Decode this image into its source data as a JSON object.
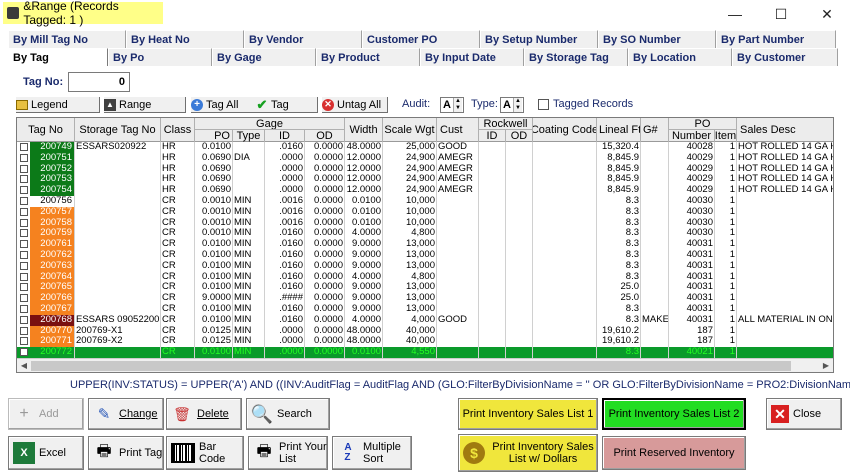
{
  "window": {
    "title": "&Range  (Records Tagged:  1 )",
    "minimize_glyph": "—",
    "maximize_glyph": "☐",
    "close_glyph": "✕"
  },
  "tabs_back": [
    "By Mill Tag No",
    "By Heat No",
    "By Vendor",
    "Customer PO",
    "By Setup Number",
    "By SO Number",
    "By Part Number"
  ],
  "tabs_front": [
    "By Tag",
    "By Po",
    "By Gage",
    "By Product",
    "By Input Date",
    "By Storage Tag",
    "By Location",
    "By Customer"
  ],
  "tag_no": {
    "label": "Tag No:",
    "value": "0"
  },
  "toolbar": {
    "legend": "Legend",
    "range": "Range",
    "tag_all": "Tag All",
    "tag": "Tag",
    "untag_all": "Untag All",
    "audit_label": "Audit:",
    "audit_value": "A",
    "type_label": "Type:",
    "type_value": "A",
    "tagged_records": "Tagged Records"
  },
  "grid": {
    "headers": {
      "tag_no": "Tag No",
      "storage_tag_no": "Storage Tag No",
      "class": "Class",
      "gage": "Gage",
      "gage_po": "PO",
      "gage_type": "Type",
      "gage_id": "ID",
      "gage_od": "OD",
      "width": "Width",
      "scale_wgt": "Scale Wgt",
      "cust": "Cust",
      "rockwell": "Rockwell",
      "rock_id": "ID",
      "rock_od": "OD",
      "coating_code": "Coating Code",
      "lineal_ft": "Lineal Ft",
      "g_num": "G#",
      "po": "PO",
      "po_number": "Number",
      "po_item": "Item",
      "sales_desc": "Sales Desc"
    },
    "rows": [
      {
        "tag": "200749",
        "color": "#0c7a18",
        "storage": "ESSARS020922",
        "class": "HR",
        "po": "0.0100",
        "type": "",
        "id": ".0160",
        "od": "0.0000",
        "width": "48.0000",
        "wgt": "25,000",
        "cust": "GOOD",
        "lineal": "15,320.4",
        "g": "",
        "ponum": "40028",
        "item": "1",
        "desc": "HOT ROLLED 14 GA HSLA"
      },
      {
        "tag": "200751",
        "color": "#0c7a18",
        "storage": "",
        "class": "HR",
        "po": "0.0690",
        "type": "DIA",
        "id": ".0000",
        "od": "0.0000",
        "width": "12.0000",
        "wgt": "24,900",
        "cust": "AMEGR",
        "lineal": "8,845.9",
        "g": "",
        "ponum": "40029",
        "item": "1",
        "desc": "HOT ROLLED 14 GA HSLA"
      },
      {
        "tag": "200752",
        "color": "#0c7a18",
        "storage": "",
        "class": "HR",
        "po": "0.0690",
        "type": "",
        "id": ".0000",
        "od": "0.0000",
        "width": "12.0000",
        "wgt": "24,900",
        "cust": "AMEGR",
        "lineal": "8,845.9",
        "g": "",
        "ponum": "40029",
        "item": "1",
        "desc": "HOT ROLLED 14 GA HSLA"
      },
      {
        "tag": "200753",
        "color": "#0c7a18",
        "storage": "",
        "class": "HR",
        "po": "0.0690",
        "type": "",
        "id": ".0000",
        "od": "0.0000",
        "width": "12.0000",
        "wgt": "24,900",
        "cust": "AMEGR",
        "lineal": "8,845.9",
        "g": "",
        "ponum": "40029",
        "item": "1",
        "desc": "HOT ROLLED 14 GA HSLA"
      },
      {
        "tag": "200754",
        "color": "#0c7a18",
        "storage": "",
        "class": "HR",
        "po": "0.0690",
        "type": "",
        "id": ".0000",
        "od": "0.0000",
        "width": "12.0000",
        "wgt": "24,900",
        "cust": "AMEGR",
        "lineal": "8,845.9",
        "g": "",
        "ponum": "40029",
        "item": "1",
        "desc": "HOT ROLLED 14 GA HSLA"
      },
      {
        "tag": "200756",
        "color": "#ffffff",
        "storage": "",
        "class": "CR",
        "po": "0.0010",
        "type": "MIN",
        "id": ".0016",
        "od": "0.0000",
        "width": "0.0100",
        "wgt": "10,000",
        "cust": "",
        "lineal": "8.3",
        "g": "",
        "ponum": "40030",
        "item": "1",
        "desc": ""
      },
      {
        "tag": "200757",
        "color": "#f5821f",
        "storage": "",
        "class": "CR",
        "po": "0.0010",
        "type": "MIN",
        "id": ".0016",
        "od": "0.0000",
        "width": "0.0100",
        "wgt": "10,000",
        "cust": "",
        "lineal": "8.3",
        "g": "",
        "ponum": "40030",
        "item": "1",
        "desc": ""
      },
      {
        "tag": "200758",
        "color": "#f5821f",
        "storage": "",
        "class": "CR",
        "po": "0.0010",
        "type": "MIN",
        "id": ".0016",
        "od": "0.0000",
        "width": "0.0100",
        "wgt": "10,000",
        "cust": "",
        "lineal": "8.3",
        "g": "",
        "ponum": "40030",
        "item": "1",
        "desc": ""
      },
      {
        "tag": "200759",
        "color": "#f5821f",
        "storage": "",
        "class": "CR",
        "po": "0.0010",
        "type": "MIN",
        "id": ".0160",
        "od": "0.0000",
        "width": "4.0000",
        "wgt": "4,800",
        "cust": "",
        "lineal": "8.3",
        "g": "",
        "ponum": "40030",
        "item": "1",
        "desc": ""
      },
      {
        "tag": "200761",
        "color": "#f5821f",
        "storage": "",
        "class": "CR",
        "po": "0.0100",
        "type": "MIN",
        "id": ".0160",
        "od": "0.0000",
        "width": "9.0000",
        "wgt": "13,000",
        "cust": "",
        "lineal": "8.3",
        "g": "",
        "ponum": "40031",
        "item": "1",
        "desc": ""
      },
      {
        "tag": "200762",
        "color": "#f5821f",
        "storage": "",
        "class": "CR",
        "po": "0.0100",
        "type": "MIN",
        "id": ".0160",
        "od": "0.0000",
        "width": "9.0000",
        "wgt": "13,000",
        "cust": "",
        "lineal": "8.3",
        "g": "",
        "ponum": "40031",
        "item": "1",
        "desc": ""
      },
      {
        "tag": "200763",
        "color": "#f5821f",
        "storage": "",
        "class": "CR",
        "po": "0.0100",
        "type": "MIN",
        "id": ".0160",
        "od": "0.0000",
        "width": "9.0000",
        "wgt": "13,000",
        "cust": "",
        "lineal": "8.3",
        "g": "",
        "ponum": "40031",
        "item": "1",
        "desc": ""
      },
      {
        "tag": "200764",
        "color": "#f5821f",
        "storage": "",
        "class": "CR",
        "po": "0.0100",
        "type": "MIN",
        "id": ".0160",
        "od": "0.0000",
        "width": "4.0000",
        "wgt": "4,800",
        "cust": "",
        "lineal": "8.3",
        "g": "",
        "ponum": "40031",
        "item": "1",
        "desc": ""
      },
      {
        "tag": "200765",
        "color": "#f5821f",
        "storage": "",
        "class": "CR",
        "po": "0.0100",
        "type": "MIN",
        "id": ".0160",
        "od": "0.0000",
        "width": "9.0000",
        "wgt": "13,000",
        "cust": "",
        "lineal": "25.0",
        "g": "",
        "ponum": "40031",
        "item": "1",
        "desc": ""
      },
      {
        "tag": "200766",
        "color": "#f5821f",
        "storage": "",
        "class": "CR",
        "po": "9.0000",
        "type": "MIN",
        "id": ".####",
        "od": "0.0000",
        "width": "9.0000",
        "wgt": "13,000",
        "cust": "",
        "lineal": "25.0",
        "g": "",
        "ponum": "40031",
        "item": "1",
        "desc": ""
      },
      {
        "tag": "200767",
        "color": "#f5821f",
        "storage": "",
        "class": "CR",
        "po": "0.0100",
        "type": "MIN",
        "id": ".0160",
        "od": "0.0000",
        "width": "9.0000",
        "wgt": "13,000",
        "cust": "",
        "lineal": "8.3",
        "g": "",
        "ponum": "40031",
        "item": "1",
        "desc": ""
      },
      {
        "tag": "200768",
        "color": "#7a1010",
        "storage": "ESSARS 09052200",
        "class": "CR",
        "po": "0.0100",
        "type": "MIN",
        "id": ".0160",
        "od": "0.0000",
        "width": "4.0000",
        "wgt": "4,000",
        "cust": "GOOD",
        "lineal": "8.3",
        "g": "MAKE",
        "ponum": "40031",
        "item": "1",
        "desc": "ALL MATERIAL IN ONE S"
      },
      {
        "tag": "200770",
        "color": "#f5821f",
        "storage": "200769-X1",
        "class": "CR",
        "po": "0.0125",
        "type": "MIN",
        "id": ".0000",
        "od": "0.0000",
        "width": "48.0000",
        "wgt": "40,000",
        "cust": "",
        "lineal": "19,610.2",
        "g": "",
        "ponum": "187",
        "item": "1",
        "desc": ""
      },
      {
        "tag": "200771",
        "color": "#f5821f",
        "storage": "200769-X2",
        "class": "CR",
        "po": "0.0125",
        "type": "MIN",
        "id": ".0000",
        "od": "0.0000",
        "width": "48.0000",
        "wgt": "40,000",
        "cust": "",
        "lineal": "19,610.2",
        "g": "",
        "ponum": "187",
        "item": "1",
        "desc": ""
      },
      {
        "tag": "200772",
        "color": "#0a9a2a",
        "storage": "",
        "class": "CR",
        "po": "0.0100",
        "type": "MIN",
        "id": ".0000",
        "od": "0.0000",
        "width": "0.0100",
        "wgt": "4,550",
        "cust": "",
        "lineal": "8.3",
        "g": "",
        "ponum": "40021",
        "item": "1",
        "desc": "",
        "selected": true
      }
    ]
  },
  "filter_text": "UPPER(INV:STATUS) = UPPER('A') AND ((INV:AuditFlag = AuditFlag AND (GLO:FilterByDivisionName = '' OR GLO:FilterByDivisionName = PRO2:DivisionName)))",
  "buttons": {
    "add": "Add",
    "change": "Change",
    "delete": "Delete",
    "search": "Search",
    "excel": "Excel",
    "print_tag": "Print Tag",
    "bar_code": "Bar Code",
    "print_your_list": "Print Your List",
    "multiple_sort": "Multiple Sort",
    "print_sales_list_1": "Print Inventory Sales List 1",
    "print_sales_list_2": "Print Inventory Sales List 2",
    "print_sales_dollars": "Print Inventory Sales List w/ Dollars",
    "print_reserved": "Print Reserved Inventory",
    "close": "Close"
  },
  "colors": {
    "tagged_green": "#0c7a18",
    "orange": "#f5821f",
    "dark_red": "#7a1010",
    "selected_row": "#0a9a2a",
    "yellow_btn": "#f0e63c",
    "green_btn": "#22dd22",
    "rose_btn": "#d79a9a"
  }
}
